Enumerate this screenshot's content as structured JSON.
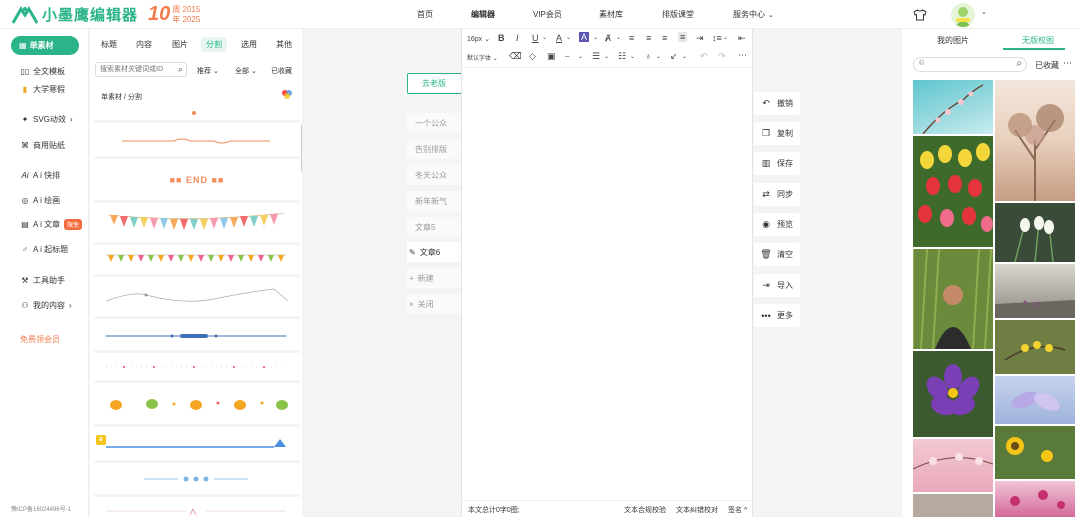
{
  "header": {
    "logo_text": "小墨鹰编辑器",
    "anniversary_number": "10",
    "anniversary_line1": "周 2015",
    "anniversary_line2": "年 2025",
    "nav": [
      {
        "label": "首页"
      },
      {
        "label": "编辑器"
      },
      {
        "label": "VIP会员"
      },
      {
        "label": "素材库"
      },
      {
        "label": "排版课堂"
      },
      {
        "label": "服务中心"
      }
    ],
    "brand_color": "#2bb48a"
  },
  "sidebar": {
    "main_label": "单素材",
    "items": [
      {
        "label": "全文模板",
        "icon": "template-icon"
      },
      {
        "label": "大学寒假",
        "icon": "bookmark-icon"
      },
      {
        "label": "SVG动效",
        "icon": "svg-effect-icon"
      },
      {
        "label": "商用贴纸",
        "icon": "sticker-icon"
      },
      {
        "label": "A i 快排",
        "icon": "ai-layout-icon"
      },
      {
        "label": "A i 绘画",
        "icon": "palette-icon"
      },
      {
        "label": "A i 文章",
        "icon": "ai-article-icon",
        "badge": "限免"
      },
      {
        "label": "A i 起标题",
        "icon": "ai-title-icon"
      },
      {
        "label": "工具助手",
        "icon": "tools-icon"
      },
      {
        "label": "我的内容",
        "icon": "user-icon"
      }
    ],
    "vip_link": "免费领会员",
    "icp": "豫ICP备16024496号-1"
  },
  "materials": {
    "tabs": [
      "标题",
      "内容",
      "图片",
      "分割",
      "选用",
      "其他"
    ],
    "active_tab": "分割",
    "search_placeholder": "搜索素材关键词或ID",
    "filter_recommend": "推荐",
    "filter_all": "全部",
    "filter_collected": "已收藏",
    "breadcrumb": "单素材 / 分割",
    "end_text": "■■ END ■■"
  },
  "articles": {
    "old_version": "去老版",
    "items": [
      "一个公众",
      "告别排版",
      "冬天公众",
      "新年新气",
      "文章5",
      "文章6"
    ],
    "active_item": "文章6",
    "new_label": "新建",
    "close_label": "关闭"
  },
  "editor": {
    "font_size": "16px",
    "default_font": "默认字体",
    "footer_stats": "本文总计0字0图;",
    "footer_check": "文本合规校验",
    "footer_typo": "文本纠错校对",
    "footer_signature": "签名"
  },
  "actions": [
    {
      "label": "撤销",
      "icon": "undo-icon"
    },
    {
      "label": "复制",
      "icon": "copy-icon"
    },
    {
      "label": "保存",
      "icon": "save-icon"
    },
    {
      "label": "同步",
      "icon": "sync-icon"
    },
    {
      "label": "预览",
      "icon": "preview-icon"
    },
    {
      "label": "清空",
      "icon": "trash-icon"
    },
    {
      "label": "导入",
      "icon": "import-icon"
    },
    {
      "label": "更多",
      "icon": "more-icon"
    }
  ],
  "right_panel": {
    "tab_mine": "我的图片",
    "tab_free": "无版权图",
    "collected": "已收藏"
  }
}
